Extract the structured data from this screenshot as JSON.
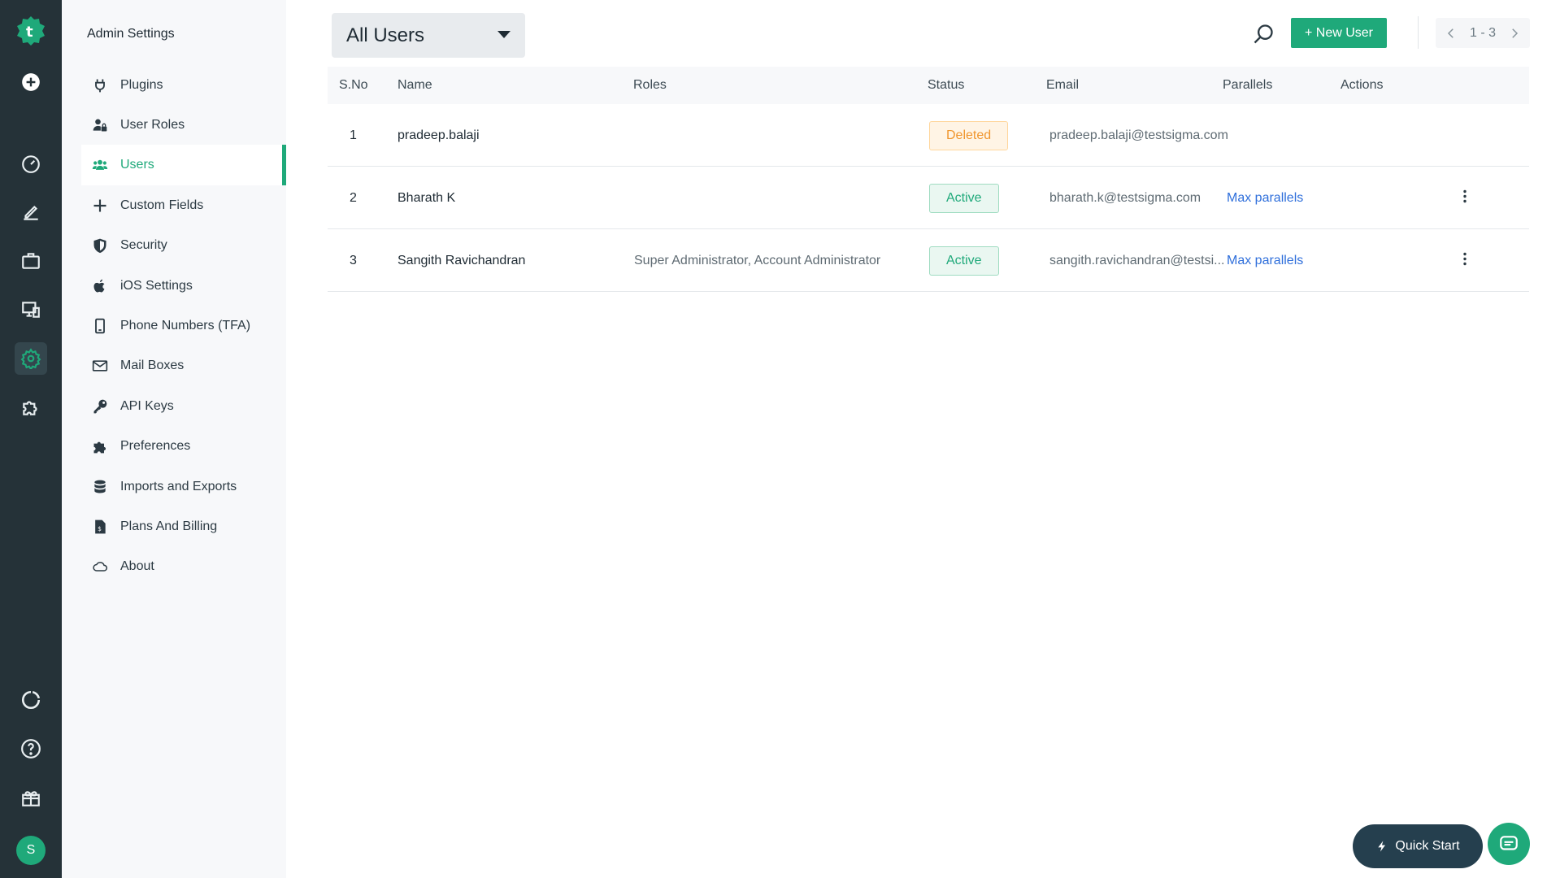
{
  "sidebar": {
    "title": "Admin Settings",
    "items": [
      {
        "label": "Plugins",
        "icon": "plug-icon"
      },
      {
        "label": "User Roles",
        "icon": "user-lock-icon"
      },
      {
        "label": "Users",
        "icon": "users-icon",
        "active": true
      },
      {
        "label": "Custom Fields",
        "icon": "plus-icon"
      },
      {
        "label": "Security",
        "icon": "shield-icon"
      },
      {
        "label": "iOS Settings",
        "icon": "apple-icon"
      },
      {
        "label": "Phone Numbers (TFA)",
        "icon": "phone-icon"
      },
      {
        "label": "Mail Boxes",
        "icon": "mail-icon"
      },
      {
        "label": "API Keys",
        "icon": "key-icon"
      },
      {
        "label": "Preferences",
        "icon": "puzzle-icon"
      },
      {
        "label": "Imports and Exports",
        "icon": "database-icon"
      },
      {
        "label": "Plans And Billing",
        "icon": "invoice-icon"
      },
      {
        "label": "About",
        "icon": "cloud-icon"
      }
    ]
  },
  "rail": {
    "avatar_initial": "S",
    "icons": [
      "logo-icon",
      "add-circle-icon",
      "dashboard-icon",
      "edit-icon",
      "briefcase-icon",
      "devices-icon",
      "settings-icon",
      "puzzle-icon",
      "refresh-icon",
      "help-icon",
      "gift-icon"
    ]
  },
  "toolbar": {
    "filter_value": "All Users",
    "new_user_label": "+ New User",
    "pager_text": "1 - 3"
  },
  "table": {
    "headers": {
      "sno": "S.No",
      "name": "Name",
      "roles": "Roles",
      "status": "Status",
      "email": "Email",
      "parallels": "Parallels",
      "actions": "Actions"
    },
    "rows": [
      {
        "sno": "1",
        "name": "pradeep.balaji",
        "roles": "",
        "status": "Deleted",
        "email": "pradeep.balaji@testsigma.com",
        "parallels": ""
      },
      {
        "sno": "2",
        "name": "Bharath K",
        "roles": "",
        "status": "Active",
        "email": "bharath.k@testsigma.com",
        "parallels": "Max parallels"
      },
      {
        "sno": "3",
        "name": "Sangith Ravichandran",
        "roles": "Super Administrator, Account Administrator",
        "status": "Active",
        "email": "sangith.ravichandran@testsi...",
        "parallels": "Max parallels"
      }
    ]
  },
  "quick_start_label": "Quick Start",
  "colors": {
    "accent": "#1fa97a",
    "rail_bg": "#253238",
    "deleted": "#f0962e",
    "link": "#2f6fdb"
  }
}
